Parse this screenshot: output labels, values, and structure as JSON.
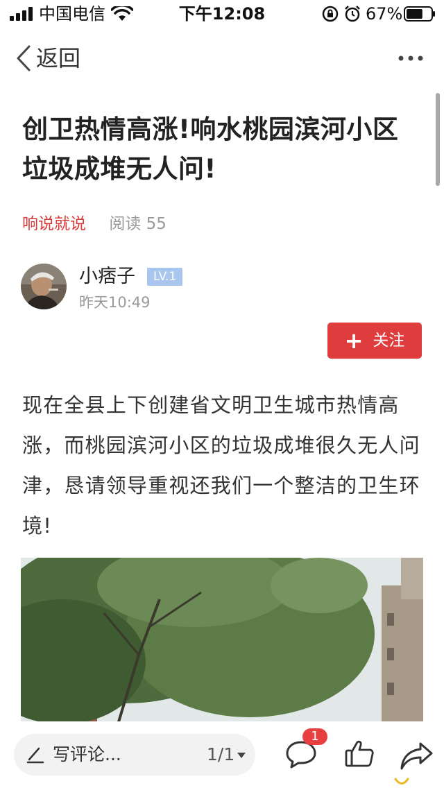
{
  "status_bar": {
    "carrier": "中国电信",
    "time": "下午12:08",
    "battery_percent": "67%",
    "battery_level": 0.67
  },
  "nav": {
    "back_label": "返回"
  },
  "article": {
    "title": "创卫热情高涨!响水桃园滨河小区垃圾成堆无人问!",
    "source": "响说就说",
    "reads": "阅读 55",
    "author": {
      "name": "小痞子",
      "level": "LV.1",
      "time": "昨天10:49"
    },
    "follow_label": "关注",
    "body": "现在全县上下创建省文明卫生城市热情高涨，而桃园滨河小区的垃圾成堆很久无人问津，恳请领导重视还我们一个整洁的卫生环境!"
  },
  "bottom_bar": {
    "comment_placeholder": "写评论...",
    "pager": "1/1",
    "comment_count": "1"
  },
  "colors": {
    "accent_red": "#df3d3d",
    "source_red": "#d83a3a",
    "level_badge": "#a9c7ee",
    "muted_text": "#9a9a9a"
  },
  "icons": [
    "signal-icon",
    "wifi-icon",
    "lock-rotation-icon",
    "alarm-icon",
    "battery-icon",
    "back-chevron-icon",
    "more-icon",
    "plus-icon",
    "pen-icon",
    "comment-icon",
    "thumbs-up-icon",
    "share-icon"
  ]
}
